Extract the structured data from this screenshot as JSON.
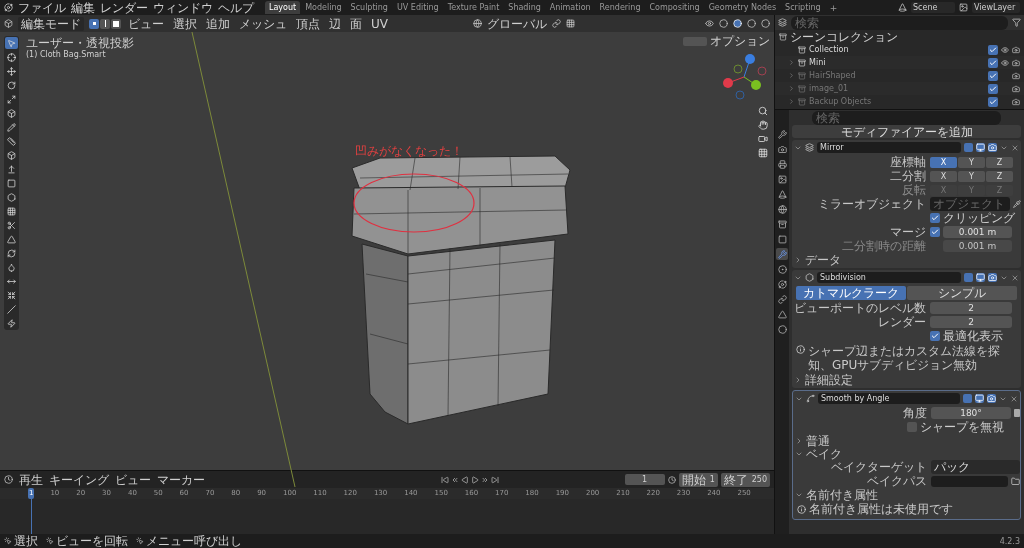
{
  "topbar": {
    "menus": [
      "ファイル",
      "編集",
      "レンダー",
      "ウィンドウ",
      "ヘルプ"
    ],
    "workspaces": [
      {
        "label": "Layout",
        "selected": true
      },
      {
        "label": "Modeling",
        "selected": false
      },
      {
        "label": "Sculpting",
        "selected": false
      },
      {
        "label": "UV Editing",
        "selected": false
      },
      {
        "label": "Texture Paint",
        "selected": false
      },
      {
        "label": "Shading",
        "selected": false
      },
      {
        "label": "Animation",
        "selected": false
      },
      {
        "label": "Rendering",
        "selected": false
      },
      {
        "label": "Compositing",
        "selected": false
      },
      {
        "label": "Geometry Nodes",
        "selected": false
      },
      {
        "label": "Scripting",
        "selected": false
      }
    ],
    "add_tab": "+",
    "scene": "Scene",
    "view_layer": "ViewLayer"
  },
  "viewport": {
    "mode": "編集モード",
    "select_modes": [
      {
        "kind": "vertex",
        "selected": true
      },
      {
        "kind": "edge",
        "selected": false
      },
      {
        "kind": "face",
        "selected": false
      }
    ],
    "menus": [
      "ビュー",
      "選択",
      "追加",
      "メッシュ",
      "頂点",
      "辺",
      "面",
      "UV"
    ],
    "orientation": "グローバル",
    "options": "オプション",
    "view_name": "ユーザー・透視投影",
    "object_name": "(1) Cloth Bag.Smart",
    "annotation": "凹みがなくなった！",
    "tools": [
      {
        "kind": "select",
        "selected": true
      },
      {
        "kind": "cursor",
        "selected": false
      },
      {
        "kind": "move",
        "selected": false
      },
      {
        "kind": "rotate",
        "selected": false
      },
      {
        "kind": "scale",
        "selected": false
      },
      {
        "kind": "transform",
        "selected": false
      },
      {
        "kind": "annotate",
        "selected": false
      },
      {
        "kind": "measure",
        "selected": false
      },
      {
        "kind": "cube",
        "selected": false
      },
      {
        "kind": "extrude",
        "selected": false
      },
      {
        "kind": "inset",
        "selected": false
      },
      {
        "kind": "bevel",
        "selected": false
      },
      {
        "kind": "loopcut",
        "selected": false
      },
      {
        "kind": "knife",
        "selected": false
      },
      {
        "kind": "polybuild",
        "selected": false
      },
      {
        "kind": "spin",
        "selected": false
      },
      {
        "kind": "smooth",
        "selected": false
      },
      {
        "kind": "slide",
        "selected": false
      },
      {
        "kind": "shrink",
        "selected": false
      },
      {
        "kind": "shear",
        "selected": false
      },
      {
        "kind": "rip",
        "selected": false
      }
    ]
  },
  "outliner": {
    "search_placeholder": "検索",
    "root": "シーンコレクション",
    "items": [
      {
        "name": "Collection",
        "kind": "collection",
        "visible": true,
        "selectable": true
      },
      {
        "name": "Mini",
        "kind": "object",
        "visible": true,
        "selectable": true
      },
      {
        "name": "HairShaped",
        "kind": "object",
        "visible": false,
        "selectable": true
      },
      {
        "name": "image_01",
        "kind": "object",
        "visible": false,
        "selectable": true
      },
      {
        "name": "Backup Objects",
        "kind": "object",
        "visible": false,
        "selectable": true
      }
    ]
  },
  "properties": {
    "search_placeholder": "検索",
    "add_modifier": "モディファイアーを追加",
    "tabs": [
      {
        "kind": "tool",
        "selected": false
      },
      {
        "kind": "render",
        "selected": false
      },
      {
        "kind": "output",
        "selected": false
      },
      {
        "kind": "view",
        "selected": false
      },
      {
        "kind": "scene",
        "selected": false
      },
      {
        "kind": "world",
        "selected": false
      },
      {
        "kind": "collection",
        "selected": false
      },
      {
        "kind": "object",
        "selected": false
      },
      {
        "kind": "modifier",
        "selected": true
      },
      {
        "kind": "particles",
        "selected": false
      },
      {
        "kind": "physics",
        "selected": false
      },
      {
        "kind": "constraints",
        "selected": false
      },
      {
        "kind": "data",
        "selected": false
      },
      {
        "kind": "material",
        "selected": false
      }
    ],
    "modifiers": [
      {
        "kind": "mirror",
        "name": "Mirror",
        "axis_rows": [
          {
            "label": "座標軸",
            "disabled": false,
            "options": [
              {
                "label": "X",
                "selected": true
              },
              {
                "label": "Y",
                "selected": false
              },
              {
                "label": "Z",
                "selected": false
              }
            ]
          },
          {
            "label": "二分割",
            "disabled": false,
            "options": [
              {
                "label": "X",
                "selected": false
              },
              {
                "label": "Y",
                "selected": false
              },
              {
                "label": "Z",
                "selected": false
              }
            ]
          },
          {
            "label": "反転",
            "disabled": true,
            "options": [
              {
                "label": "X",
                "selected": false
              },
              {
                "label": "Y",
                "selected": false
              },
              {
                "label": "Z",
                "selected": false
              }
            ]
          }
        ],
        "mirror_object": {
          "label": "ミラーオブジェクト",
          "placeholder": "オブジェクト"
        },
        "clipping": {
          "label": "クリッピング",
          "checked": true
        },
        "merge": {
          "label": "マージ",
          "checked": true,
          "value": "0.001 m"
        },
        "bisect_distance": {
          "label": "二分割時の距離",
          "value": "0.001 m",
          "disabled": true
        },
        "data": {
          "label": "データ",
          "expanded": false
        }
      },
      {
        "kind": "subdivision",
        "name": "Subdivision",
        "methods": [
          {
            "label": "カトマルクラーク",
            "selected": true
          },
          {
            "label": "シンプル",
            "selected": false
          }
        ],
        "levels_viewport": {
          "label": "ビューポートのレベル数",
          "value": "2"
        },
        "render": {
          "label": "レンダー",
          "value": "2"
        },
        "optimal": {
          "label": "最適化表示",
          "checked": true
        },
        "info": "シャープ辺またはカスタム法線を探知、GPUサブディビジョン無効",
        "advanced": {
          "label": "詳細設定",
          "expanded": false
        }
      },
      {
        "kind": "smooth",
        "name": "Smooth by Angle",
        "angle": {
          "label": "角度",
          "value": "180°"
        },
        "ignore_sharp": {
          "label": "シャープを無視",
          "checked": false
        },
        "panels": [
          {
            "label": "普通",
            "expanded": false
          },
          {
            "label": "ベイク",
            "expanded": true
          }
        ],
        "bake_target": {
          "label": "ベイクターゲット",
          "value": "パック"
        },
        "bake_path": {
          "label": "ベイクパス"
        },
        "named_attrs": {
          "label": "名前付き属性",
          "expanded": true,
          "info": "名前付き属性は未使用です"
        }
      }
    ]
  },
  "timeline": {
    "menus": [
      "再生",
      "キーイング",
      "ビュー",
      "マーカー"
    ],
    "current_frame": "1",
    "start_label": "開始",
    "start": "1",
    "end_label": "終了",
    "end": "250",
    "ticks": [
      {
        "label": "1",
        "selected": true
      },
      {
        "label": "10",
        "selected": false
      },
      {
        "label": "20",
        "selected": false
      },
      {
        "label": "30",
        "selected": false
      },
      {
        "label": "40",
        "selected": false
      },
      {
        "label": "50",
        "selected": false
      },
      {
        "label": "60",
        "selected": false
      },
      {
        "label": "70",
        "selected": false
      },
      {
        "label": "80",
        "selected": false
      },
      {
        "label": "90",
        "selected": false
      },
      {
        "label": "100",
        "selected": false
      },
      {
        "label": "110",
        "selected": false
      },
      {
        "label": "120",
        "selected": false
      },
      {
        "label": "130",
        "selected": false
      },
      {
        "label": "140",
        "selected": false
      },
      {
        "label": "150",
        "selected": false
      },
      {
        "label": "160",
        "selected": false
      },
      {
        "label": "170",
        "selected": false
      },
      {
        "label": "180",
        "selected": false
      },
      {
        "label": "190",
        "selected": false
      },
      {
        "label": "200",
        "selected": false
      },
      {
        "label": "210",
        "selected": false
      },
      {
        "label": "220",
        "selected": false
      },
      {
        "label": "230",
        "selected": false
      },
      {
        "label": "240",
        "selected": false
      },
      {
        "label": "250",
        "selected": false
      }
    ]
  },
  "status_bar": {
    "hints": [
      "選択",
      "ビューを回転",
      "メニュー呼び出し"
    ],
    "version": "4.2.3"
  }
}
